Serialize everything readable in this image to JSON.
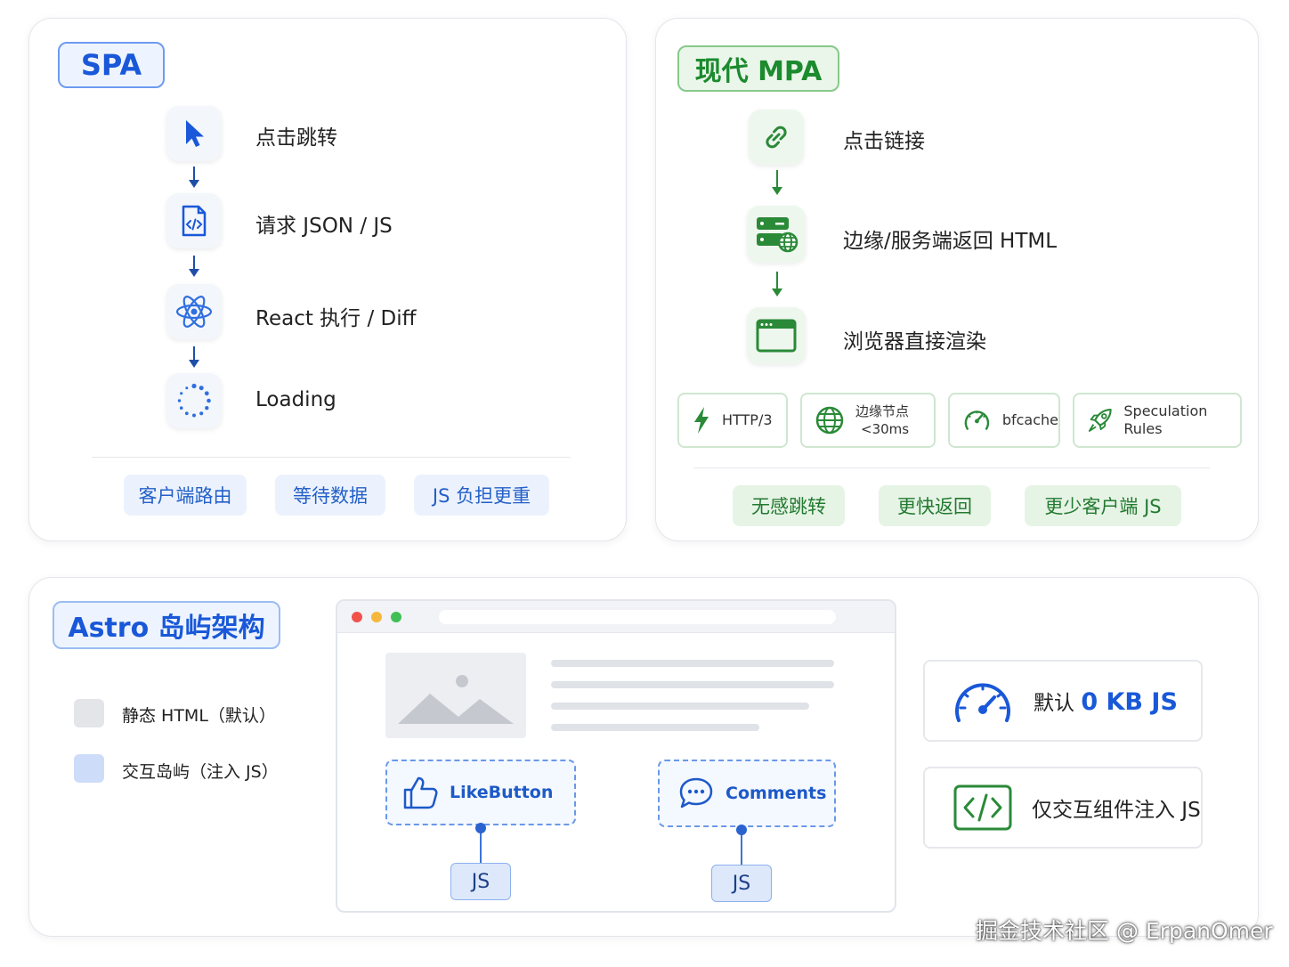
{
  "spa": {
    "title": "SPA",
    "steps": [
      {
        "label": "点击跳转",
        "icon": "cursor-icon"
      },
      {
        "label": "请求 JSON / JS",
        "icon": "code-file-icon"
      },
      {
        "label": "React 执行 / Diff",
        "icon": "react-atom-icon"
      },
      {
        "label": "Loading",
        "icon": "spinner-icon"
      }
    ],
    "chips": [
      "客户端路由",
      "等待数据",
      "JS 负担更重"
    ]
  },
  "mpa": {
    "title": "现代 MPA",
    "steps": [
      {
        "label": "点击链接",
        "icon": "link-icon"
      },
      {
        "label": "边缘/服务端返回 HTML",
        "icon": "server-globe-icon"
      },
      {
        "label": "浏览器直接渲染",
        "icon": "browser-window-icon"
      }
    ],
    "features": [
      {
        "label": "HTTP/3",
        "icon": "lightning-icon"
      },
      {
        "line1": "边缘节点",
        "line2": "<30ms",
        "icon": "globe-icon"
      },
      {
        "label": "bfcache",
        "icon": "speedometer-icon"
      },
      {
        "label": "Speculation Rules",
        "icon": "rocket-icon"
      }
    ],
    "chips": [
      "无感跳转",
      "更快返回",
      "更少客户端 JS"
    ]
  },
  "astro": {
    "title": "Astro 岛屿架构",
    "legend": [
      {
        "label": "静态 HTML（默认）",
        "color": "#e3e5e8"
      },
      {
        "label": "交互岛屿（注入 JS）",
        "color": "#cddcf9"
      }
    ],
    "islands": [
      {
        "label": "LikeButton",
        "icon": "thumbs-up-icon",
        "js": "JS"
      },
      {
        "label": "Comments",
        "icon": "chat-bubble-icon",
        "js": "JS"
      }
    ],
    "info": [
      {
        "prefix": "默认 ",
        "highlight": "0 KB JS",
        "icon": "gauge-icon"
      },
      {
        "prefix": "仅交互组件注入 JS",
        "highlight": "",
        "icon": "code-brackets-icon"
      }
    ]
  },
  "watermark": "掘金技术社区 @ ErpanOmer",
  "colors": {
    "spa_accent": "#1958d8",
    "mpa_accent": "#1c8a2e",
    "island_border": "#6a98e8"
  }
}
